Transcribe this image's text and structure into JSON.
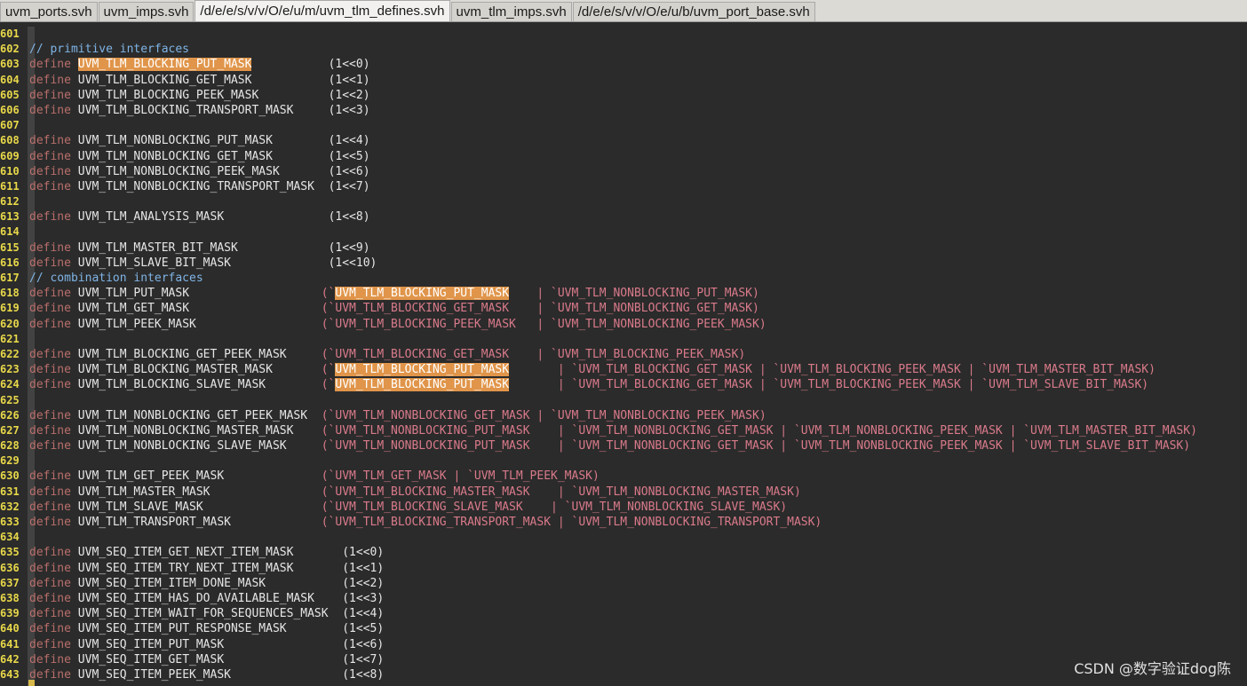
{
  "tabs": [
    {
      "label": "uvm_ports.svh",
      "active": false
    },
    {
      "label": "uvm_imps.svh",
      "active": false
    },
    {
      "label": "/d/e/e/s/v/v/O/e/u/m/uvm_tlm_defines.svh",
      "active": true
    },
    {
      "label": "uvm_tlm_imps.svh",
      "active": false
    },
    {
      "label": "/d/e/e/s/v/v/O/e/u/b/uvm_port_base.svh",
      "active": false
    }
  ],
  "lines": [
    {
      "n": "601",
      "segs": []
    },
    {
      "n": "602",
      "segs": [
        {
          "t": "// primitive interfaces",
          "c": "cm"
        }
      ]
    },
    {
      "n": "603",
      "segs": [
        {
          "t": "define ",
          "c": "kw"
        },
        {
          "t": "UVM_TLM_BLOCKING_PUT_MASK",
          "c": "hl"
        },
        {
          "t": "           ",
          "c": "id"
        },
        {
          "t": "(1<<0)",
          "c": "num"
        }
      ]
    },
    {
      "n": "604",
      "segs": [
        {
          "t": "define ",
          "c": "kw"
        },
        {
          "t": "UVM_TLM_BLOCKING_GET_MASK           ",
          "c": "id"
        },
        {
          "t": "(1<<1)",
          "c": "num"
        }
      ]
    },
    {
      "n": "605",
      "segs": [
        {
          "t": "define ",
          "c": "kw"
        },
        {
          "t": "UVM_TLM_BLOCKING_PEEK_MASK          ",
          "c": "id"
        },
        {
          "t": "(1<<2)",
          "c": "num"
        }
      ]
    },
    {
      "n": "606",
      "segs": [
        {
          "t": "define ",
          "c": "kw"
        },
        {
          "t": "UVM_TLM_BLOCKING_TRANSPORT_MASK     ",
          "c": "id"
        },
        {
          "t": "(1<<3)",
          "c": "num"
        }
      ]
    },
    {
      "n": "607",
      "segs": []
    },
    {
      "n": "608",
      "segs": [
        {
          "t": "define ",
          "c": "kw"
        },
        {
          "t": "UVM_TLM_NONBLOCKING_PUT_MASK        ",
          "c": "id"
        },
        {
          "t": "(1<<4)",
          "c": "num"
        }
      ]
    },
    {
      "n": "609",
      "segs": [
        {
          "t": "define ",
          "c": "kw"
        },
        {
          "t": "UVM_TLM_NONBLOCKING_GET_MASK        ",
          "c": "id"
        },
        {
          "t": "(1<<5)",
          "c": "num"
        }
      ]
    },
    {
      "n": "610",
      "segs": [
        {
          "t": "define ",
          "c": "kw"
        },
        {
          "t": "UVM_TLM_NONBLOCKING_PEEK_MASK       ",
          "c": "id"
        },
        {
          "t": "(1<<6)",
          "c": "num"
        }
      ]
    },
    {
      "n": "611",
      "segs": [
        {
          "t": "define ",
          "c": "kw"
        },
        {
          "t": "UVM_TLM_NONBLOCKING_TRANSPORT_MASK  ",
          "c": "id"
        },
        {
          "t": "(1<<7)",
          "c": "num"
        }
      ]
    },
    {
      "n": "612",
      "segs": []
    },
    {
      "n": "613",
      "segs": [
        {
          "t": "define ",
          "c": "kw"
        },
        {
          "t": "UVM_TLM_ANALYSIS_MASK               ",
          "c": "id"
        },
        {
          "t": "(1<<8)",
          "c": "num"
        }
      ]
    },
    {
      "n": "614",
      "segs": []
    },
    {
      "n": "615",
      "segs": [
        {
          "t": "define ",
          "c": "kw"
        },
        {
          "t": "UVM_TLM_MASTER_BIT_MASK             ",
          "c": "id"
        },
        {
          "t": "(1<<9)",
          "c": "num"
        }
      ]
    },
    {
      "n": "616",
      "segs": [
        {
          "t": "define ",
          "c": "kw"
        },
        {
          "t": "UVM_TLM_SLAVE_BIT_MASK              ",
          "c": "id"
        },
        {
          "t": "(1<<10)",
          "c": "num"
        }
      ]
    },
    {
      "n": "617",
      "segs": [
        {
          "t": "// combination interfaces",
          "c": "cm"
        }
      ]
    },
    {
      "n": "618",
      "segs": [
        {
          "t": "define ",
          "c": "kw"
        },
        {
          "t": "UVM_TLM_PUT_MASK                   ",
          "c": "id"
        },
        {
          "t": "(`",
          "c": "ref"
        },
        {
          "t": "UVM_TLM_BLOCKING_PUT_MASK",
          "c": "hl"
        },
        {
          "t": "    | `UVM_TLM_NONBLOCKING_PUT_MASK)",
          "c": "ref"
        }
      ]
    },
    {
      "n": "619",
      "segs": [
        {
          "t": "define ",
          "c": "kw"
        },
        {
          "t": "UVM_TLM_GET_MASK                   ",
          "c": "id"
        },
        {
          "t": "(`UVM_TLM_BLOCKING_GET_MASK    | `UVM_TLM_NONBLOCKING_GET_MASK)",
          "c": "ref"
        }
      ]
    },
    {
      "n": "620",
      "segs": [
        {
          "t": "define ",
          "c": "kw"
        },
        {
          "t": "UVM_TLM_PEEK_MASK                  ",
          "c": "id"
        },
        {
          "t": "(`UVM_TLM_BLOCKING_PEEK_MASK   | `UVM_TLM_NONBLOCKING_PEEK_MASK)",
          "c": "ref"
        }
      ]
    },
    {
      "n": "621",
      "segs": []
    },
    {
      "n": "622",
      "segs": [
        {
          "t": "define ",
          "c": "kw"
        },
        {
          "t": "UVM_TLM_BLOCKING_GET_PEEK_MASK     ",
          "c": "id"
        },
        {
          "t": "(`UVM_TLM_BLOCKING_GET_MASK    | `UVM_TLM_BLOCKING_PEEK_MASK)",
          "c": "ref"
        }
      ]
    },
    {
      "n": "623",
      "segs": [
        {
          "t": "define ",
          "c": "kw"
        },
        {
          "t": "UVM_TLM_BLOCKING_MASTER_MASK       ",
          "c": "id"
        },
        {
          "t": "(`",
          "c": "ref"
        },
        {
          "t": "UVM_TLM_BLOCKING_PUT_MASK",
          "c": "hl"
        },
        {
          "t": "       | `UVM_TLM_BLOCKING_GET_MASK | `UVM_TLM_BLOCKING_PEEK_MASK | `UVM_TLM_MASTER_BIT_MASK)",
          "c": "ref"
        }
      ]
    },
    {
      "n": "624",
      "segs": [
        {
          "t": "define ",
          "c": "kw"
        },
        {
          "t": "UVM_TLM_BLOCKING_SLAVE_MASK        ",
          "c": "id"
        },
        {
          "t": "(`",
          "c": "ref"
        },
        {
          "t": "UVM_TLM_BLOCKING_PUT_MASK",
          "c": "hl"
        },
        {
          "t": "       | `UVM_TLM_BLOCKING_GET_MASK | `UVM_TLM_BLOCKING_PEEK_MASK | `UVM_TLM_SLAVE_BIT_MASK)",
          "c": "ref"
        }
      ]
    },
    {
      "n": "625",
      "segs": []
    },
    {
      "n": "626",
      "segs": [
        {
          "t": "define ",
          "c": "kw"
        },
        {
          "t": "UVM_TLM_NONBLOCKING_GET_PEEK_MASK  ",
          "c": "id"
        },
        {
          "t": "(`UVM_TLM_NONBLOCKING_GET_MASK | `UVM_TLM_NONBLOCKING_PEEK_MASK)",
          "c": "ref"
        }
      ]
    },
    {
      "n": "627",
      "segs": [
        {
          "t": "define ",
          "c": "kw"
        },
        {
          "t": "UVM_TLM_NONBLOCKING_MASTER_MASK    ",
          "c": "id"
        },
        {
          "t": "(`UVM_TLM_NONBLOCKING_PUT_MASK    | `UVM_TLM_NONBLOCKING_GET_MASK | `UVM_TLM_NONBLOCKING_PEEK_MASK | `UVM_TLM_MASTER_BIT_MASK)",
          "c": "ref"
        }
      ]
    },
    {
      "n": "628",
      "segs": [
        {
          "t": "define ",
          "c": "kw"
        },
        {
          "t": "UVM_TLM_NONBLOCKING_SLAVE_MASK     ",
          "c": "id"
        },
        {
          "t": "(`UVM_TLM_NONBLOCKING_PUT_MASK    | `UVM_TLM_NONBLOCKING_GET_MASK | `UVM_TLM_NONBLOCKING_PEEK_MASK | `UVM_TLM_SLAVE_BIT_MASK)",
          "c": "ref"
        }
      ]
    },
    {
      "n": "629",
      "segs": []
    },
    {
      "n": "630",
      "segs": [
        {
          "t": "define ",
          "c": "kw"
        },
        {
          "t": "UVM_TLM_GET_PEEK_MASK              ",
          "c": "id"
        },
        {
          "t": "(`UVM_TLM_GET_MASK | `UVM_TLM_PEEK_MASK)",
          "c": "ref"
        }
      ]
    },
    {
      "n": "631",
      "segs": [
        {
          "t": "define ",
          "c": "kw"
        },
        {
          "t": "UVM_TLM_MASTER_MASK                ",
          "c": "id"
        },
        {
          "t": "(`UVM_TLM_BLOCKING_MASTER_MASK    | `UVM_TLM_NONBLOCKING_MASTER_MASK)",
          "c": "ref"
        }
      ]
    },
    {
      "n": "632",
      "segs": [
        {
          "t": "define ",
          "c": "kw"
        },
        {
          "t": "UVM_TLM_SLAVE_MASK                 ",
          "c": "id"
        },
        {
          "t": "(`UVM_TLM_BLOCKING_SLAVE_MASK    | `UVM_TLM_NONBLOCKING_SLAVE_MASK)",
          "c": "ref"
        }
      ]
    },
    {
      "n": "633",
      "segs": [
        {
          "t": "define ",
          "c": "kw"
        },
        {
          "t": "UVM_TLM_TRANSPORT_MASK             ",
          "c": "id"
        },
        {
          "t": "(`UVM_TLM_BLOCKING_TRANSPORT_MASK | `UVM_TLM_NONBLOCKING_TRANSPORT_MASK)",
          "c": "ref"
        }
      ]
    },
    {
      "n": "634",
      "segs": []
    },
    {
      "n": "635",
      "segs": [
        {
          "t": "define ",
          "c": "kw"
        },
        {
          "t": "UVM_SEQ_ITEM_GET_NEXT_ITEM_MASK       ",
          "c": "id"
        },
        {
          "t": "(1<<0)",
          "c": "num"
        }
      ]
    },
    {
      "n": "636",
      "segs": [
        {
          "t": "define ",
          "c": "kw"
        },
        {
          "t": "UVM_SEQ_ITEM_TRY_NEXT_ITEM_MASK       ",
          "c": "id"
        },
        {
          "t": "(1<<1)",
          "c": "num"
        }
      ]
    },
    {
      "n": "637",
      "segs": [
        {
          "t": "define ",
          "c": "kw"
        },
        {
          "t": "UVM_SEQ_ITEM_ITEM_DONE_MASK           ",
          "c": "id"
        },
        {
          "t": "(1<<2)",
          "c": "num"
        }
      ]
    },
    {
      "n": "638",
      "segs": [
        {
          "t": "define ",
          "c": "kw"
        },
        {
          "t": "UVM_SEQ_ITEM_HAS_DO_AVAILABLE_MASK    ",
          "c": "id"
        },
        {
          "t": "(1<<3)",
          "c": "num"
        }
      ]
    },
    {
      "n": "639",
      "segs": [
        {
          "t": "define ",
          "c": "kw"
        },
        {
          "t": "UVM_SEQ_ITEM_WAIT_FOR_SEQUENCES_MASK  ",
          "c": "id"
        },
        {
          "t": "(1<<4)",
          "c": "num"
        }
      ]
    },
    {
      "n": "640",
      "segs": [
        {
          "t": "define ",
          "c": "kw"
        },
        {
          "t": "UVM_SEQ_ITEM_PUT_RESPONSE_MASK        ",
          "c": "id"
        },
        {
          "t": "(1<<5)",
          "c": "num"
        }
      ]
    },
    {
      "n": "641",
      "segs": [
        {
          "t": "define ",
          "c": "kw"
        },
        {
          "t": "UVM_SEQ_ITEM_PUT_MASK                 ",
          "c": "id"
        },
        {
          "t": "(1<<6)",
          "c": "num"
        }
      ]
    },
    {
      "n": "642",
      "segs": [
        {
          "t": "define ",
          "c": "kw"
        },
        {
          "t": "UVM_SEQ_ITEM_GET_MASK                 ",
          "c": "id"
        },
        {
          "t": "(1<<7)",
          "c": "num"
        }
      ]
    },
    {
      "n": "643",
      "segs": [
        {
          "t": "define ",
          "c": "kw"
        },
        {
          "t": "UVM_SEQ_ITEM_PEEK_MASK                ",
          "c": "id"
        },
        {
          "t": "(1<<8)",
          "c": "num"
        }
      ]
    }
  ],
  "watermark": "CSDN @数字验证dog陈"
}
